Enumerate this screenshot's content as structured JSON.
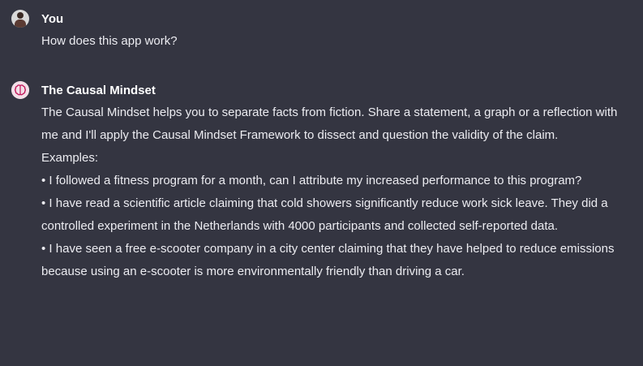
{
  "messages": {
    "user": {
      "author": "You",
      "text": "How does this app work?"
    },
    "bot": {
      "author": "The Causal Mindset",
      "intro": "The Causal Mindset helps you to separate facts from fiction. Share a statement, a graph or a reflection with me and I'll apply the Causal Mindset Framework to dissect and question the validity of the claim.",
      "examples_label": "Examples:",
      "examples": [
        "• I followed a fitness program for a month, can I attribute my increased performance to this program?",
        "• I have read a scientific article claiming that cold showers significantly reduce work sick leave. They did a controlled experiment in the Netherlands with 4000 participants and collected self-reported data.",
        "• I have seen a free e-scooter company in a city center claiming that they have helped to reduce emissions because using an e-scooter is more environmentally friendly than driving a car."
      ]
    }
  },
  "icons": {
    "user_avatar": "user-photo-avatar",
    "bot_avatar": "brain-icon"
  },
  "colors": {
    "background": "#343541",
    "text": "#ececf1",
    "author": "#ffffff",
    "bot_avatar_bg": "#f3dfe8",
    "bot_avatar_icon": "#c2185b"
  }
}
